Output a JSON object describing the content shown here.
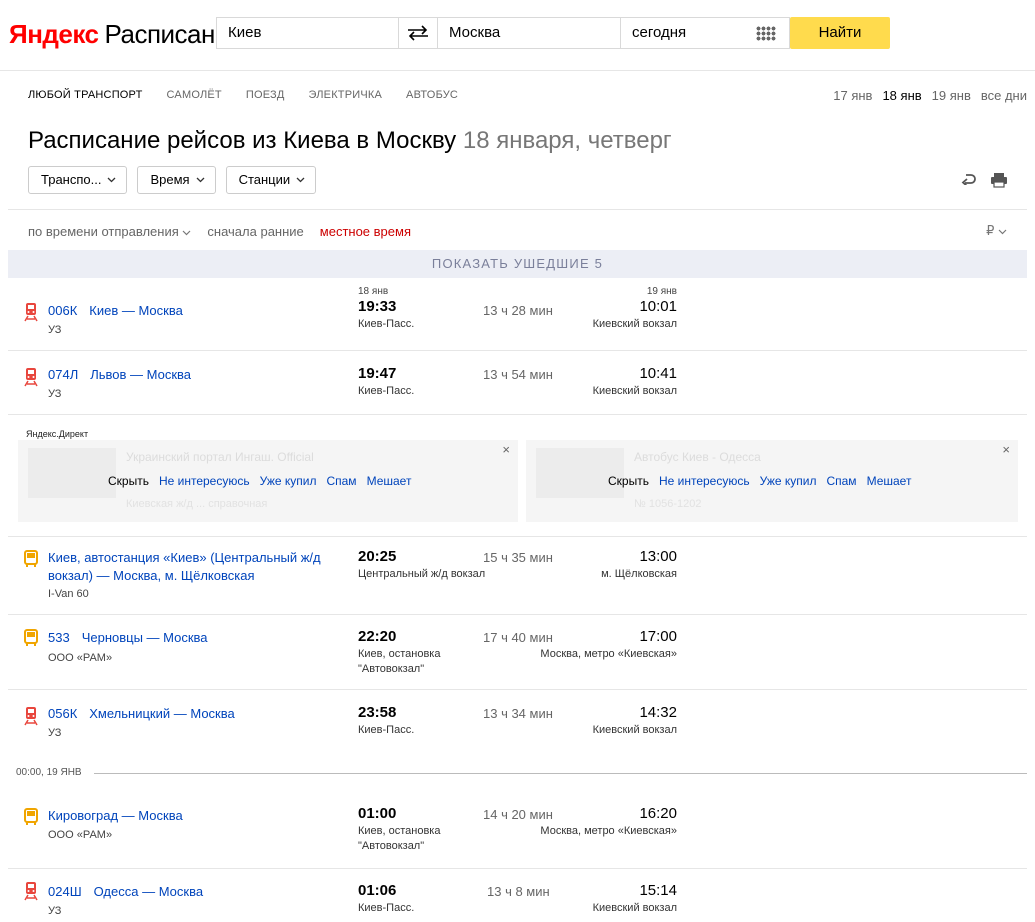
{
  "header": {
    "logo_brand": "Яндекс",
    "logo_product": "Расписания",
    "from": "Киев",
    "to": "Москва",
    "date": "сегодня",
    "find_label": "Найти"
  },
  "tabs": [
    "ЛЮБОЙ ТРАНСПОРТ",
    "САМОЛЁТ",
    "ПОЕЗД",
    "ЭЛЕКТРИЧКА",
    "АВТОБУС"
  ],
  "days": [
    "17 янв",
    "18 янв",
    "19 янв",
    "все дни"
  ],
  "title": {
    "main": "Расписание рейсов из Киева в Москву",
    "sub": "18 января, четверг"
  },
  "dropdowns": [
    "Транспо...",
    "Время",
    "Станции"
  ],
  "sort": {
    "by": "по времени отправления",
    "order": "сначала ранние",
    "localtime": "местное время",
    "currency": "₽"
  },
  "show_gone": {
    "label": "ПОКАЗАТЬ УШЕДШИЕ",
    "count": "5"
  },
  "rows": [
    {
      "type": "train",
      "num": "006К",
      "route": "Киев — Москва",
      "carrier": "УЗ",
      "dep_date": "18 янв",
      "dep": "19:33",
      "dep_st": "Киев-Пасс.",
      "dur": "13 ч 28 мин",
      "arr_date": "19 янв",
      "arr": "10:01",
      "arr_st": "Киевский вокзал"
    },
    {
      "type": "train",
      "num": "074Л",
      "route": "Львов — Москва",
      "carrier": "УЗ",
      "dep": "19:47",
      "dep_st": "Киев-Пасс.",
      "dur": "13 ч 54 мин",
      "arr": "10:41",
      "arr_st": "Киевский вокзал"
    },
    {
      "type": "bus",
      "route": "Киев, автостанция «Киев» (Центральный ж/д вокзал) — Москва, м. Щёлковская",
      "carrier": "I-Van 60",
      "dep": "20:25",
      "dep_st": "Центральный ж/д вокзал",
      "dur": "15 ч 35 мин",
      "arr": "13:00",
      "arr_st": "м. Щёлковская"
    },
    {
      "type": "bus",
      "num": "533",
      "route": "Черновцы — Москва",
      "carrier": "ООО «РАМ»",
      "dep": "22:20",
      "dep_st": "Киев, остановка \"Автовокзал\"",
      "dur": "17 ч 40 мин",
      "arr": "17:00",
      "arr_st": "Москва, метро «Киевская»"
    },
    {
      "type": "train",
      "num": "056К",
      "route": "Хмельницкий — Москва",
      "carrier": "УЗ",
      "dep": "23:58",
      "dep_st": "Киев-Пасс.",
      "dur": "13 ч 34 мин",
      "arr": "14:32",
      "arr_st": "Киевский вокзал"
    },
    {
      "type": "bus",
      "route": "Кировоград — Москва",
      "carrier": "ООО «РАМ»",
      "dep": "01:00",
      "dep_st": "Киев, остановка \"Автовокзал\"",
      "dur": "14 ч 20 мин",
      "arr": "16:20",
      "arr_st": "Москва, метро «Киевская»"
    },
    {
      "type": "train",
      "num": "024Ш",
      "route": "Одесса — Москва",
      "carrier": "УЗ",
      "dep": "01:06",
      "dep_st": "Киев-Пасс.",
      "dur": "13 ч 8 мин",
      "arr": "15:14",
      "arr_st": "Киевский вокзал"
    }
  ],
  "ads": {
    "label": "Яндекс.Директ",
    "hide": "Скрыть",
    "options": [
      "Не интересуюсь",
      "Уже купил",
      "Спам",
      "Мешает"
    ],
    "close": "×",
    "ghost_left_title": "Украинский портал Ингаш. Official",
    "ghost_left_line": "Киевская ж/д ... справочная",
    "ghost_right_title": "Автобус Киев - Одесса",
    "ghost_right_line": "№ 1056-1202"
  },
  "day_separator": "00:00, 19 ЯНВ",
  "colors": {
    "accent_yellow": "#ffdb4d",
    "link_blue": "#0044bb",
    "train_red": "#e8463d",
    "bus_orange": "#f0a500",
    "local_time_red": "#cc0000"
  }
}
